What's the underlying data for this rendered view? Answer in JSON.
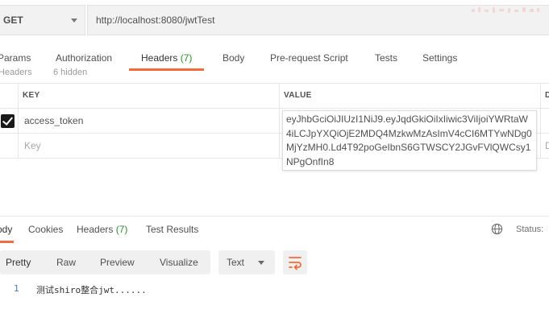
{
  "request": {
    "method": "GET",
    "url": "http://localhost:8080/jwtTest"
  },
  "request_tabs": [
    {
      "label": "Params"
    },
    {
      "label": "Authorization"
    },
    {
      "label": "Headers",
      "count": "(7)"
    },
    {
      "label": "Body"
    },
    {
      "label": "Pre-request Script"
    },
    {
      "label": "Tests"
    },
    {
      "label": "Settings"
    }
  ],
  "headers_section": {
    "label": "Headers",
    "hidden": "6 hidden"
  },
  "table": {
    "col_key": "KEY",
    "col_value": "VALUE",
    "col_desc": "D",
    "row1": {
      "checked": true,
      "key": "access_token",
      "value": "eyJhbGciOiJIUzI1NiJ9.eyJqdGkiOiIxIiwic3ViIjoiYWRtaW4iLCJpYXQiOjE2MDQ4MzkwMzAsImV4cCI6MTYwNDg0MjYzMH0.Ld4T92poGeIbnS6GTWSCY2JGvFVlQWCsy1NPgOnfIn8"
    },
    "new_row": {
      "key_placeholder": "Key",
      "desc_placeholder": "D"
    }
  },
  "response_tabs": [
    {
      "label": "Body"
    },
    {
      "label": "Cookies"
    },
    {
      "label": "Headers",
      "count": "(7)"
    },
    {
      "label": "Test Results"
    }
  ],
  "response_status": "Status:",
  "view_modes": [
    "Pretty",
    "Raw",
    "Preview",
    "Visualize"
  ],
  "format": "Text",
  "body_lines": [
    {
      "no": "1",
      "text": "测试shiro整合jwt......"
    }
  ],
  "colors": {
    "accent": "#f26b3a",
    "count_green": "#2e8b2e",
    "wrap_orange": "#f26b3a"
  }
}
